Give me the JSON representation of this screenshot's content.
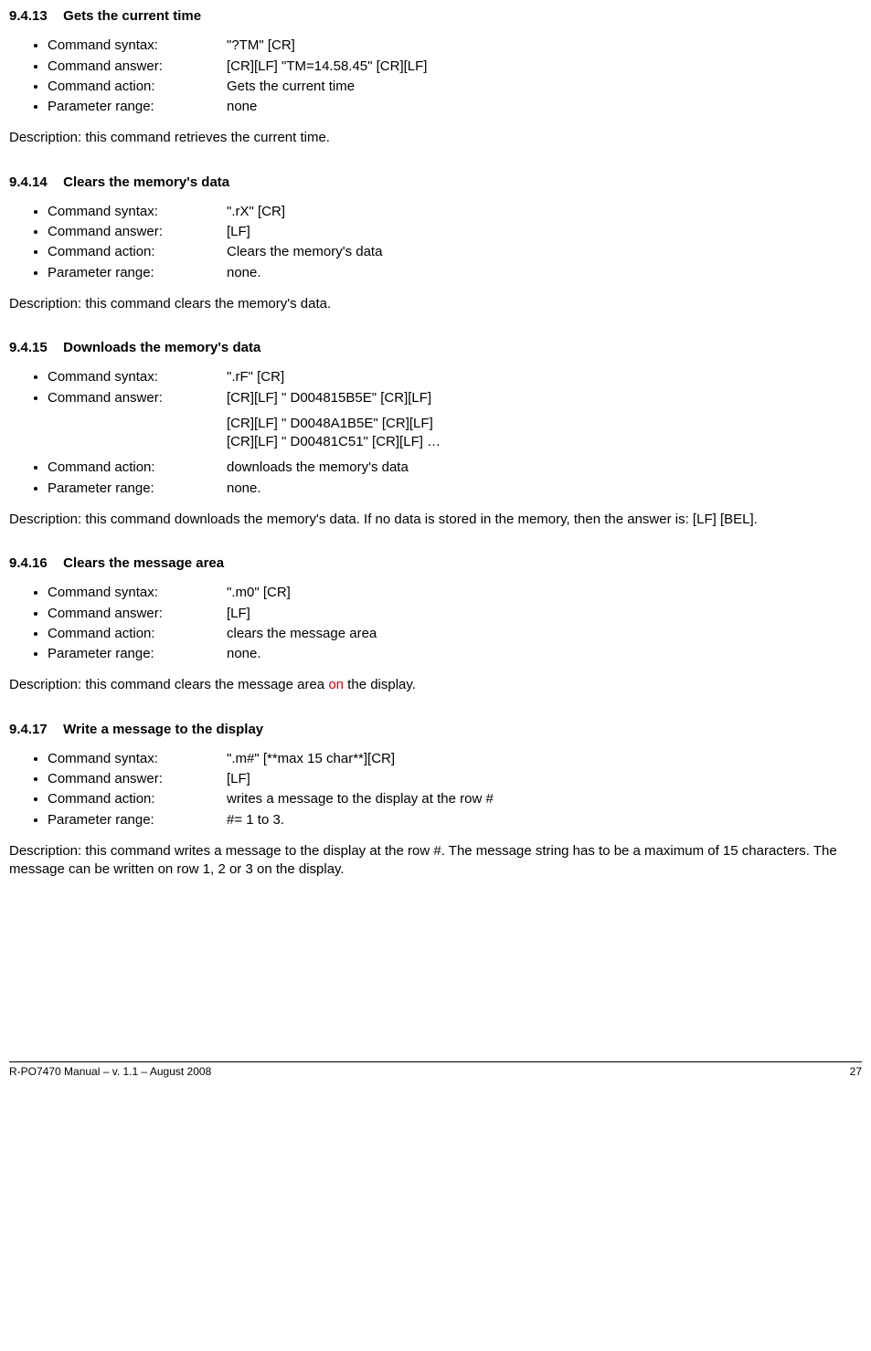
{
  "sections": [
    {
      "num": "9.4.13",
      "title": "Gets the current time",
      "items": [
        {
          "label": "Command syntax:",
          "value": "\"?TM\" [CR]"
        },
        {
          "label": "Command answer:",
          "value": "[CR][LF] \"TM=14.58.45\" [CR][LF]"
        },
        {
          "label": "Command action:",
          "value": "Gets the current time"
        },
        {
          "label": "Parameter range:",
          "value": "none"
        }
      ],
      "desc_pre": "Description: this command retrieves the current time."
    },
    {
      "num": "9.4.14",
      "title": "Clears the memory's data",
      "items": [
        {
          "label": "Command syntax:",
          "value": "\".rX\" [CR]"
        },
        {
          "label": "Command answer:",
          "value": "[LF]"
        },
        {
          "label": "Command action:",
          "value": "Clears the memory's data"
        },
        {
          "label": "Parameter range:",
          "value": "none."
        }
      ],
      "desc_pre": "Description: this command clears the memory's data."
    },
    {
      "num": "9.4.15",
      "title": "Downloads the memory's data",
      "items": [
        {
          "label": "Command syntax:",
          "value": "\".rF\" [CR]"
        },
        {
          "label": "Command answer:",
          "value": "[CR][LF] \" D004815B5E\" [CR][LF]"
        }
      ],
      "extra_lines": [
        "[CR][LF] \" D0048A1B5E\" [CR][LF]",
        "[CR][LF] \" D00481C51\" [CR][LF] …"
      ],
      "items2": [
        {
          "label": "Command action:",
          "value": "downloads the memory's data"
        },
        {
          "label": "Parameter range:",
          "value": "none."
        }
      ],
      "desc_pre": "Description: this command downloads the memory's data. If no data is stored in the memory, then the answer is: [LF] [BEL]."
    },
    {
      "num": "9.4.16",
      "title": "Clears the message area",
      "items": [
        {
          "label": "Command syntax:",
          "value": "\".m0\" [CR]"
        },
        {
          "label": "Command answer:",
          "value": "[LF]"
        },
        {
          "label": "Command action:",
          "value": "clears the message area"
        },
        {
          "label": "Parameter range:",
          "value": "none."
        }
      ],
      "desc_pre": "Description: this command clears the message area ",
      "desc_red": "on",
      "desc_post": " the display."
    },
    {
      "num": "9.4.17",
      "title": "Write a message to the display",
      "items": [
        {
          "label": "Command syntax:",
          "value": "\".m#\" [**max 15 char**][CR]"
        },
        {
          "label": "Command answer:",
          "value": "[LF]"
        },
        {
          "label": "Command action:",
          "value": "writes a message to the display at the row #"
        },
        {
          "label": "Parameter range:",
          "value": "#= 1 to 3."
        }
      ],
      "desc_pre": "Description: this command writes a message to the display at the row #. The message string has to be a maximum of 15 characters. The message can be written on row 1, 2 or 3 on the display."
    }
  ],
  "footer": {
    "left": "R-PO7470 Manual – v. 1.1 – August 2008",
    "right": "27"
  }
}
